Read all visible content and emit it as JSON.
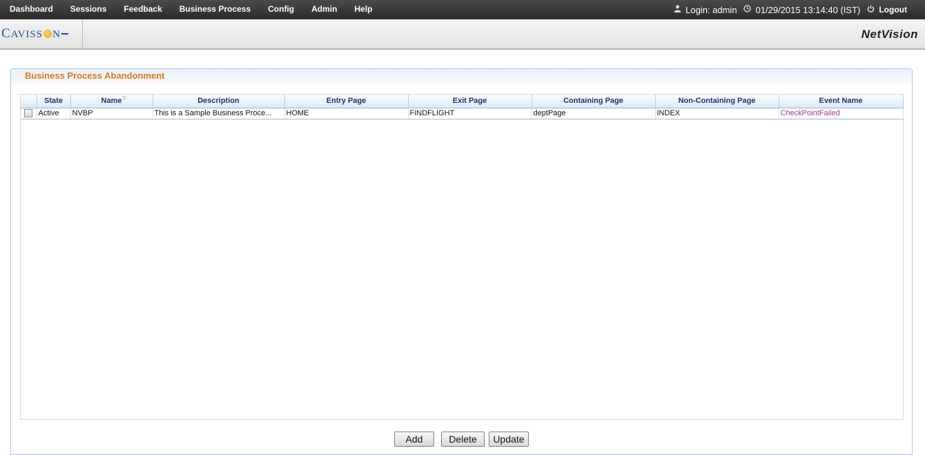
{
  "nav": {
    "items": [
      "Dashboard",
      "Sessions",
      "Feedback",
      "Business Process",
      "Config",
      "Admin",
      "Help"
    ]
  },
  "status": {
    "login": "Login: admin",
    "datetime": "01/29/2015 13:14:40 (IST)",
    "logout": "Logout"
  },
  "header": {
    "logo": "Cavisson",
    "brand": "NetVision"
  },
  "panel": {
    "title": "Business Process Abandonment"
  },
  "table": {
    "columns": [
      "State",
      "Name",
      "Description",
      "Entry Page",
      "Exit Page",
      "Containing Page",
      "Non-Containing Page",
      "Event Name"
    ],
    "rows": [
      {
        "checked": false,
        "state": "Active",
        "name": "NVBP",
        "description": "This is a Sample Business Proce...",
        "entry_page": "HOME",
        "exit_page": "FINDFLIGHT",
        "containing_page": "deptPage",
        "non_containing_page": "INDEX",
        "event_name": "CheckPointFailed"
      }
    ]
  },
  "buttons": {
    "add": "Add",
    "delete": "Delete",
    "update": "Update"
  },
  "colors": {
    "panel_title": "#e07a10",
    "header_text": "#1f2f7a",
    "event_link": "#9b3a86"
  }
}
